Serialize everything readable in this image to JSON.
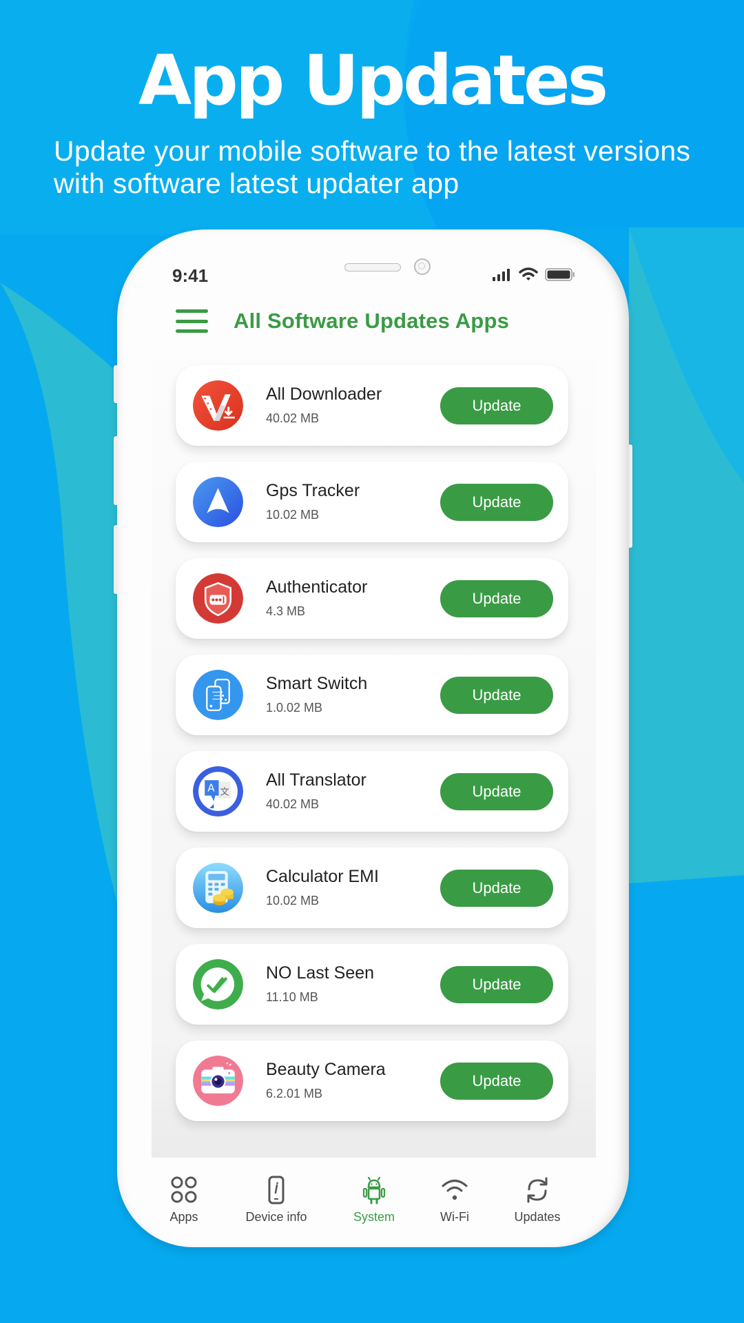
{
  "promo": {
    "headline": "App Updates",
    "subtitle_line1": "Update your mobile software to the latest versions",
    "subtitle_line2": "with software latest updater app"
  },
  "colors": {
    "background_blue": "#06a9f0",
    "background_teal": "#2bbcd3",
    "accent_green": "#3a9b45"
  },
  "status_bar": {
    "time": "9:41",
    "icons": [
      "signal-icon",
      "wifi-icon",
      "battery-icon"
    ]
  },
  "app_bar": {
    "menu_icon": "hamburger-menu-icon",
    "title": "All Software Updates Apps"
  },
  "apps": [
    {
      "name": "All Downloader",
      "size": "40.02 MB",
      "icon": "video-downloader-icon",
      "button": "Update"
    },
    {
      "name": "Gps Tracker",
      "size": "10.02 MB",
      "icon": "navigation-arrow-icon",
      "button": "Update"
    },
    {
      "name": "Authenticator",
      "size": "4.3 MB",
      "icon": "shield-password-icon",
      "button": "Update"
    },
    {
      "name": "Smart Switch",
      "size": "1.0.02 MB",
      "icon": "phone-transfer-icon",
      "button": "Update"
    },
    {
      "name": "All Translator",
      "size": "40.02 MB",
      "icon": "translate-icon",
      "button": "Update"
    },
    {
      "name": "Calculator EMI",
      "size": "10.02 MB",
      "icon": "calculator-coins-icon",
      "button": "Update"
    },
    {
      "name": "NO Last Seen",
      "size": "11.10 MB",
      "icon": "chat-double-check-icon",
      "button": "Update"
    },
    {
      "name": "Beauty Camera",
      "size": "6.2.01 MB",
      "icon": "camera-icon",
      "button": "Update"
    }
  ],
  "bottom_nav": {
    "active": "System",
    "items": [
      {
        "label": "Apps",
        "icon": "grid-icon"
      },
      {
        "label": "Device info",
        "icon": "phone-info-icon"
      },
      {
        "label": "System",
        "icon": "android-icon"
      },
      {
        "label": "Wi-Fi",
        "icon": "wifi-icon"
      },
      {
        "label": "Updates",
        "icon": "refresh-icon"
      }
    ]
  }
}
